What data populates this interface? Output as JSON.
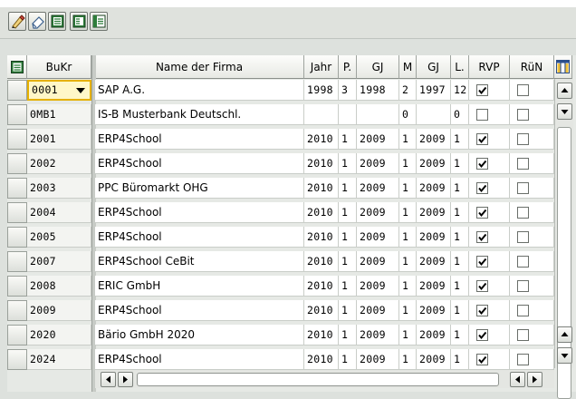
{
  "toolbar": {
    "buttons": [
      {
        "icon": "edit-pencil-icon"
      },
      {
        "icon": "display-eraser-icon"
      },
      {
        "icon": "select-all-icon"
      },
      {
        "icon": "deselect-all-icon"
      },
      {
        "icon": "select-block-icon"
      }
    ]
  },
  "table": {
    "headers": {
      "bukr": "BuKr",
      "name": "Name der Firma",
      "jahr": "Jahr",
      "p": "P.",
      "gj1": "GJ",
      "m": "M",
      "gj2": "GJ",
      "l": "L.",
      "rvp": "RVP",
      "run": "RüN"
    },
    "rows": [
      {
        "bukr": "0001",
        "name": "SAP A.G.",
        "jahr": "1998",
        "p": "3",
        "gj1": "1998",
        "m": "2",
        "gj2": "1997",
        "l": "12",
        "rvp": true,
        "run": false
      },
      {
        "bukr": "0MB1",
        "name": "IS-B Musterbank Deutschl.",
        "jahr": "",
        "p": "",
        "gj1": "",
        "m": "0",
        "gj2": "",
        "l": "0",
        "rvp": false,
        "run": false
      },
      {
        "bukr": "2001",
        "name": "ERP4School",
        "jahr": "2010",
        "p": "1",
        "gj1": "2009",
        "m": "1",
        "gj2": "2009",
        "l": "1",
        "rvp": true,
        "run": false
      },
      {
        "bukr": "2002",
        "name": "ERP4School",
        "jahr": "2010",
        "p": "1",
        "gj1": "2009",
        "m": "1",
        "gj2": "2009",
        "l": "1",
        "rvp": true,
        "run": false
      },
      {
        "bukr": "2003",
        "name": "PPC Büromarkt OHG",
        "jahr": "2010",
        "p": "1",
        "gj1": "2009",
        "m": "1",
        "gj2": "2009",
        "l": "1",
        "rvp": true,
        "run": false
      },
      {
        "bukr": "2004",
        "name": "ERP4School",
        "jahr": "2010",
        "p": "1",
        "gj1": "2009",
        "m": "1",
        "gj2": "2009",
        "l": "1",
        "rvp": true,
        "run": false
      },
      {
        "bukr": "2005",
        "name": "ERP4School",
        "jahr": "2010",
        "p": "1",
        "gj1": "2009",
        "m": "1",
        "gj2": "2009",
        "l": "1",
        "rvp": true,
        "run": false
      },
      {
        "bukr": "2007",
        "name": "ERP4School CeBit",
        "jahr": "2010",
        "p": "1",
        "gj1": "2009",
        "m": "1",
        "gj2": "2009",
        "l": "1",
        "rvp": true,
        "run": false
      },
      {
        "bukr": "2008",
        "name": "ERIC GmbH",
        "jahr": "2010",
        "p": "1",
        "gj1": "2009",
        "m": "1",
        "gj2": "2009",
        "l": "1",
        "rvp": true,
        "run": false
      },
      {
        "bukr": "2009",
        "name": "ERP4School",
        "jahr": "2010",
        "p": "1",
        "gj1": "2009",
        "m": "1",
        "gj2": "2009",
        "l": "1",
        "rvp": true,
        "run": false
      },
      {
        "bukr": "2020",
        "name": "Bärio GmbH 2020",
        "jahr": "2010",
        "p": "1",
        "gj1": "2009",
        "m": "1",
        "gj2": "2009",
        "l": "1",
        "rvp": true,
        "run": false
      },
      {
        "bukr": "2024",
        "name": "ERP4School",
        "jahr": "2010",
        "p": "1",
        "gj1": "2009",
        "m": "1",
        "gj2": "2009",
        "l": "1",
        "rvp": true,
        "run": false
      }
    ]
  },
  "colors": {
    "focus_cell": "#fff7c8",
    "header_bg": "#eef0ec",
    "grid_bg": "#e6e9e5"
  }
}
